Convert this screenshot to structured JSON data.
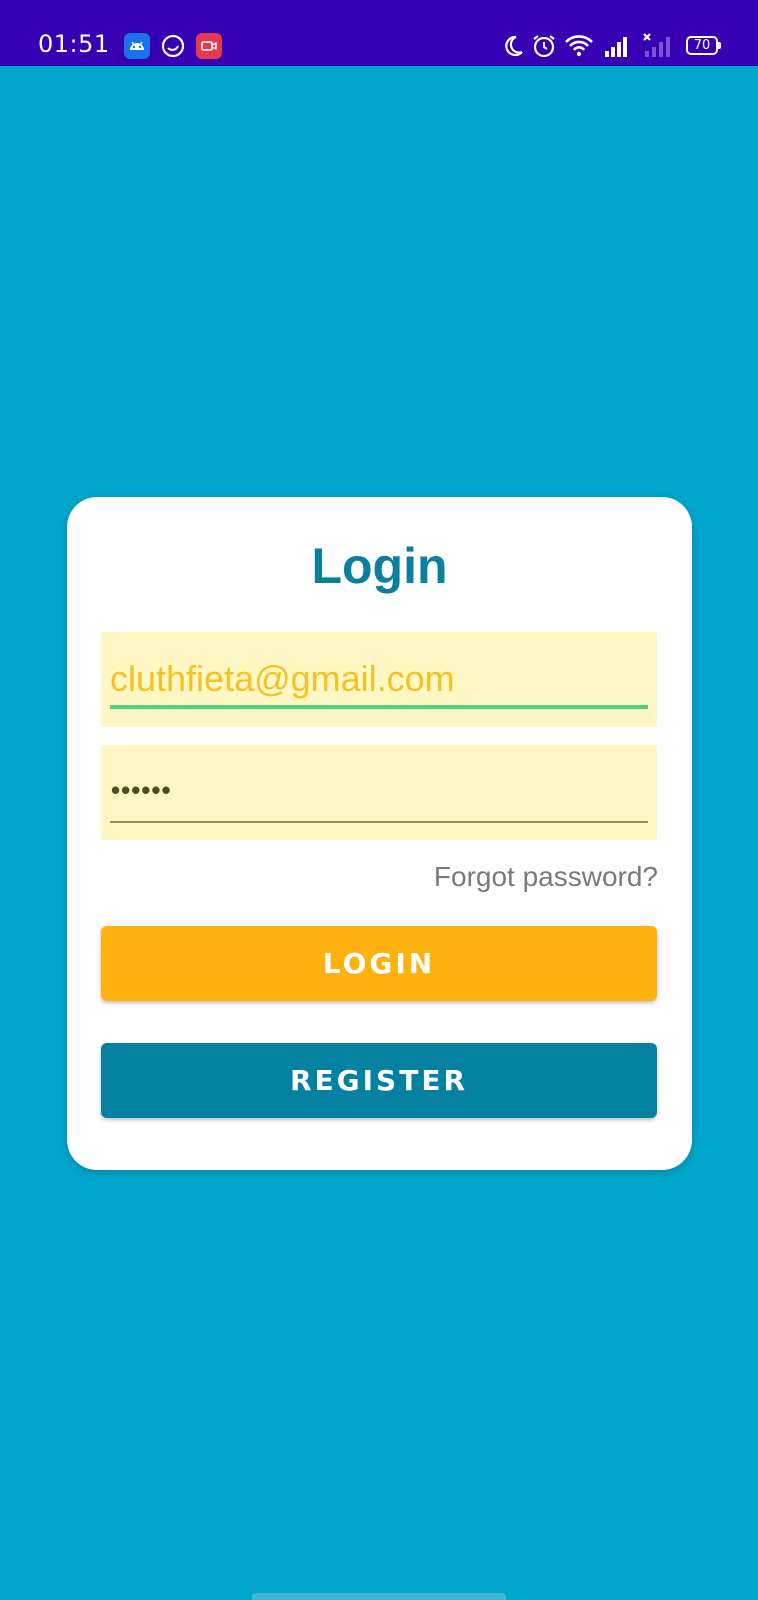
{
  "status_bar": {
    "time": "01:51",
    "left_icons": [
      "android-icon",
      "circle-arrow-icon",
      "screen-record-icon"
    ],
    "right_icons": [
      "moon-icon",
      "alarm-icon",
      "wifi-icon",
      "signal-icon",
      "signal-no-sim-icon"
    ],
    "battery": "70"
  },
  "login_card": {
    "title": "Login",
    "email": {
      "value": "cluthfieta@gmail.com"
    },
    "password": {
      "masked_value": "••••••"
    },
    "forgot_password": "Forgot password?",
    "login_button": "LOGIN",
    "register_button": "REGISTER"
  },
  "colors": {
    "background": "#00a6cc",
    "status_bar": "#3700b3",
    "title": "#0a7f9e",
    "input_bg": "#fff8c4",
    "login_button": "#ffb20e",
    "register_button": "#0481a0"
  }
}
